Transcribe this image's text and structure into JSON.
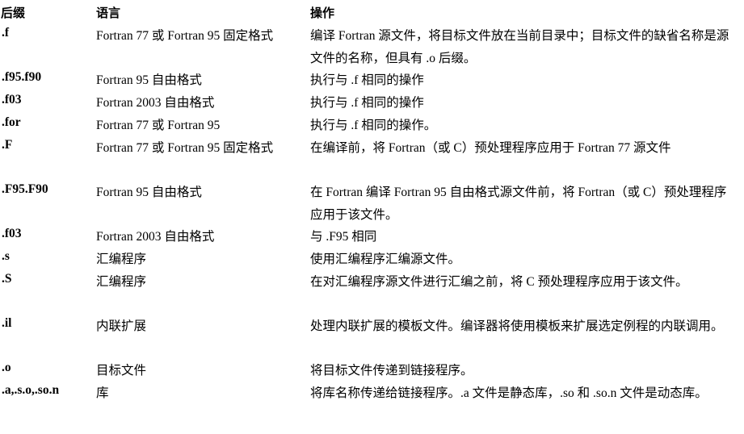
{
  "header": {
    "suffix": "后缀",
    "language": "语言",
    "operation": "操作"
  },
  "rows": [
    {
      "suffix": ".f",
      "language": "Fortran 77 或 Fortran 95 固定格式",
      "operation": "编译 Fortran 源文件，将目标文件放在当前目录中；目标文件的缺省名称是源文件的名称，但具有 .o 后缀。"
    },
    {
      "suffix": ".f95.f90",
      "language": "Fortran 95 自由格式",
      "operation": "执行与 .f 相同的操作"
    },
    {
      "suffix": ".f03",
      "language": "Fortran 2003 自由格式",
      "operation": "执行与 .f 相同的操作"
    },
    {
      "suffix": ".for",
      "language": "Fortran 77 或 Fortran 95",
      "operation": "执行与 .f 相同的操作。"
    },
    {
      "suffix": ".F",
      "language": "Fortran 77 或 Fortran 95 固定格式",
      "operation": "在编译前，将 Fortran（或 C）预处理程序应用于 Fortran 77 源文件"
    },
    {
      "suffix": ".F95.F90",
      "language": "Fortran 95 自由格式",
      "operation": "在 Fortran 编译 Fortran 95 自由格式源文件前，将 Fortran（或 C）预处理程序应用于该文件。"
    },
    {
      "suffix": ".f03",
      "language": "Fortran 2003 自由格式",
      "operation": "与 .F95 相同"
    },
    {
      "suffix": ".s",
      "language": "汇编程序",
      "operation": "使用汇编程序汇编源文件。"
    },
    {
      "suffix": ".S",
      "language": "汇编程序",
      "operation": "在对汇编程序源文件进行汇编之前，将 C 预处理程序应用于该文件。"
    },
    {
      "suffix": ".il",
      "language": "内联扩展",
      "operation": "处理内联扩展的模板文件。编译器将使用模板来扩展选定例程的内联调用。"
    },
    {
      "suffix": ".o",
      "language": "目标文件",
      "operation": "将目标文件传递到链接程序。"
    },
    {
      "suffix": ".a,.s.o,.so.n",
      "language": "库",
      "operation": "将库名称传递给链接程序。.a 文件是静态库，.so 和 .so.n 文件是动态库。"
    }
  ]
}
